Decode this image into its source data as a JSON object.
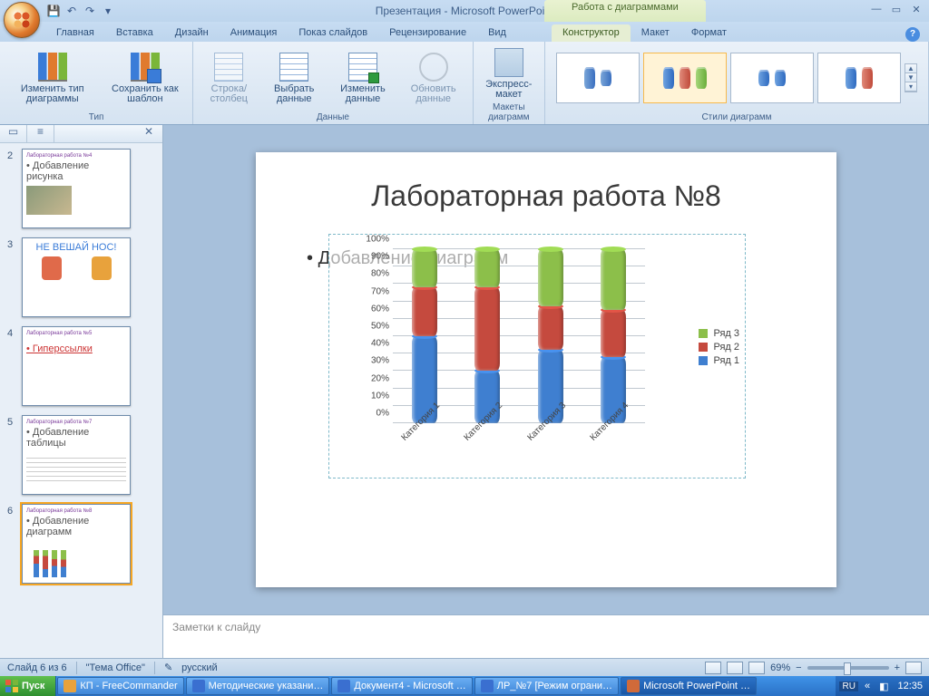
{
  "title": "Презентация - Microsoft PowerPoint",
  "tool_context": "Работа с диаграммами",
  "qat": {
    "save": "💾",
    "undo": "↶",
    "redo": "↷",
    "more": "▾"
  },
  "winctl": {
    "min": "—",
    "max": "▭",
    "close": "✕"
  },
  "tabs": [
    "Главная",
    "Вставка",
    "Дизайн",
    "Анимация",
    "Показ слайдов",
    "Рецензирование",
    "Вид"
  ],
  "tooltabs": {
    "items": [
      "Конструктор",
      "Макет",
      "Формат"
    ],
    "active": "Конструктор"
  },
  "ribbon": {
    "type": {
      "label": "Тип",
      "change": "Изменить тип диаграммы",
      "save_tpl": "Сохранить как шаблон"
    },
    "data": {
      "label": "Данные",
      "rowcol": "Строка/столбец",
      "select": "Выбрать данные",
      "edit": "Изменить данные",
      "refresh": "Обновить данные"
    },
    "layouts": {
      "label": "Макеты диаграмм",
      "quick": "Экспресс-макет"
    },
    "styles": {
      "label": "Стили диаграмм"
    }
  },
  "panel": {
    "tab_slides": "▭",
    "tab_outline": "≡",
    "close": "✕"
  },
  "thumbs": [
    {
      "n": "2",
      "title": "Лабораторная работа №4",
      "sub": "• Добавление рисунка"
    },
    {
      "n": "3",
      "title": "НЕ ВЕШАЙ НОС!"
    },
    {
      "n": "4",
      "title": "Лабораторная работа №5",
      "sub": "• Гиперссылки"
    },
    {
      "n": "5",
      "title": "Лабораторная работа №7",
      "sub": "• Добавление таблицы"
    },
    {
      "n": "6",
      "title": "Лабораторная работа №8",
      "sub": "• Добавление диаграмм"
    }
  ],
  "slide": {
    "title": "Лабораторная работа №8",
    "bullet": "Добавление диаграмм"
  },
  "chart_data": {
    "type": "bar",
    "stacked": true,
    "percent": true,
    "categories": [
      "Категория 1",
      "Категория 2",
      "Категория 3",
      "Категория 4"
    ],
    "series": [
      {
        "name": "Ряд 1",
        "color": "#3f7fd0",
        "values": [
          50,
          30,
          42,
          38
        ]
      },
      {
        "name": "Ряд 2",
        "color": "#c54a3e",
        "values": [
          28,
          48,
          25,
          27
        ]
      },
      {
        "name": "Ряд 3",
        "color": "#8cbf4a",
        "values": [
          22,
          22,
          33,
          35
        ]
      }
    ],
    "ylabels": [
      "0%",
      "10%",
      "20%",
      "30%",
      "40%",
      "50%",
      "60%",
      "70%",
      "80%",
      "90%",
      "100%"
    ],
    "ylim": [
      0,
      100
    ]
  },
  "legend_order": [
    "Ряд 3",
    "Ряд 2",
    "Ряд 1"
  ],
  "notes_placeholder": "Заметки к слайду",
  "status": {
    "slide": "Слайд 6 из 6",
    "theme": "\"Тема Office\"",
    "lang": "русский",
    "zoom": "69%"
  },
  "taskbar": {
    "start": "Пуск",
    "items": [
      {
        "label": "КП - FreeCommander",
        "icon": "#e8a23c"
      },
      {
        "label": "Методические указани…",
        "icon": "#3a6fd0"
      },
      {
        "label": "Документ4 - Microsoft …",
        "icon": "#3a6fd0"
      },
      {
        "label": "ЛР_№7 [Режим ограни…",
        "icon": "#3a6fd0"
      },
      {
        "label": "Microsoft PowerPoint …",
        "icon": "#d06a3a",
        "active": true
      }
    ],
    "lang": "RU",
    "time": "12:35",
    "tray_exp": "«"
  }
}
